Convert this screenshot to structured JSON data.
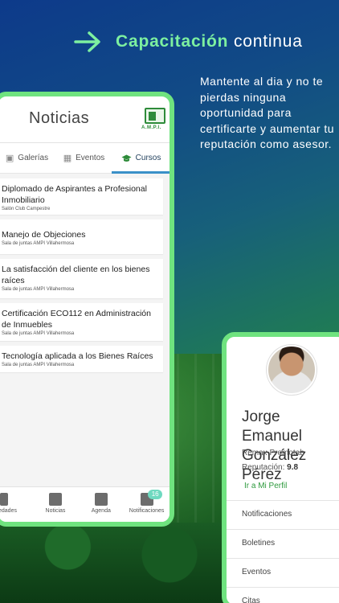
{
  "headline": {
    "accent": "Capacitación",
    "rest": "continua"
  },
  "tagline": "Mantente al dia y no te pierdas ninguna oportunidad para certificarte y aumentar tu reputación como asesor.",
  "screen1": {
    "title": "Noticias",
    "logo_text": "A.M.P.I.",
    "tabs": [
      {
        "label": "Galerías",
        "icon": "image-icon"
      },
      {
        "label": "Eventos",
        "icon": "calendar-icon"
      },
      {
        "label": "Cursos",
        "icon": "graduation-cap-icon"
      }
    ],
    "courses": [
      {
        "title": "Diplomado de Aspirantes a Profesional Inmobiliario",
        "place": "Salón Club Campestre"
      },
      {
        "title": "Manejo de Objeciones",
        "place": "Sala de juntas AMPI Villahermosa"
      },
      {
        "title": "La satisfacción del cliente en los bienes raíces",
        "place": "Sala de juntas AMPI Villahermosa"
      },
      {
        "title": "Certificación ECO112 en Administración de Inmuebles",
        "place": "Sala de juntas AMPI Villahermosa"
      },
      {
        "title": "Tecnología aplicada a los Bienes Raíces",
        "place": "Sala de juntas AMPI Villahermosa"
      }
    ],
    "nav": [
      {
        "label": "edades",
        "icon": "person-icon"
      },
      {
        "label": "Noticias",
        "icon": "newspaper-icon"
      },
      {
        "label": "Agenda",
        "icon": "agenda-icon"
      },
      {
        "label": "Notificaciones",
        "icon": "chat-icon"
      }
    ],
    "notification_count": "16"
  },
  "screen2": {
    "name": "Jorge Emanuel González Pérez",
    "company": "Remax  Promotab",
    "reputation_label": "Reputación:",
    "reputation_value": "9.8",
    "profile_link": "Ir a Mi Perfil",
    "menu": [
      "Notificaciones",
      "Boletines",
      "Eventos",
      "Citas"
    ]
  },
  "colors": {
    "accent_green": "#7df0a0",
    "frame_green": "#6fe37f",
    "tab_underline": "#3a90c8"
  }
}
